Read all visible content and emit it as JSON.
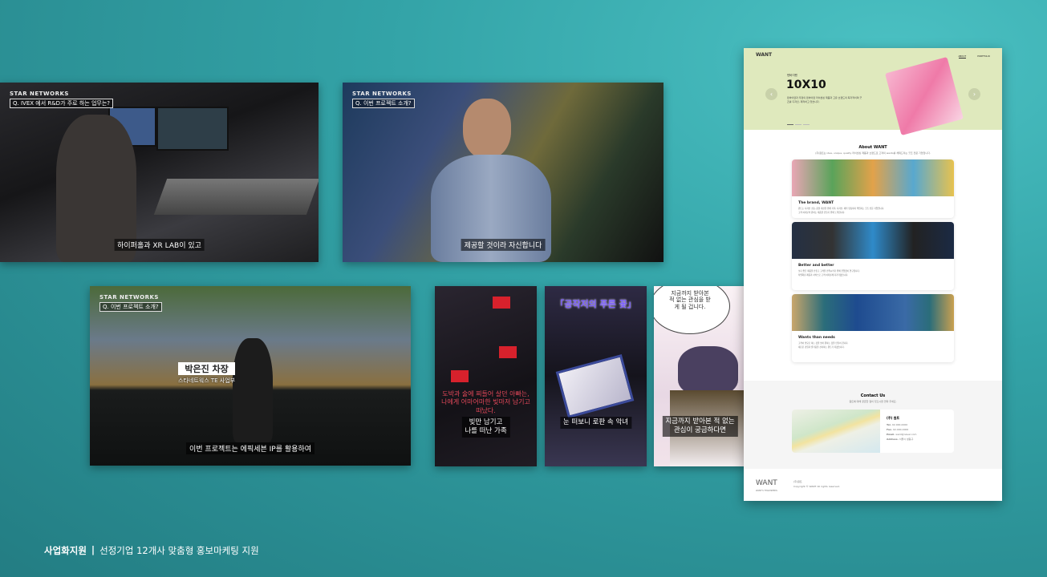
{
  "videos": [
    {
      "brand": "STAR NETWORKS",
      "question": "Q. IVEX 에서 R&D가 주로 하는 업무는?",
      "subtitle": "하이퍼홀과 XR LAB이 있고"
    },
    {
      "brand": "STAR NETWORKS",
      "question": "Q. 이번 프로젝트 소개?",
      "subtitle": "제공할 것이라 자신합니다"
    },
    {
      "brand": "STAR NETWORKS",
      "question": "Q. 이번 프로젝트 소개?",
      "subtitle": "이번 프로젝트는 에픽세븐 IP를 활용하여",
      "name": "박은진 차장",
      "role": "스타네트웍스 TE 사업부"
    }
  ],
  "comics": [
    {
      "overlay": "도박과 술에 찌들어 살던 아빠는, 나에게 어마어마한 빚마저 남기고 떠났다.",
      "caption_line1": "빚만 남기고",
      "caption_line2": "나를 떠난 가족"
    },
    {
      "title": "「공작저의 푸른 꽃」",
      "caption_line1": "눈 떠보니 로판 속 악녀"
    },
    {
      "bubble": "지금까지 받아본 적 없는 관심을 받게 될 겁니다.",
      "caption_line1": "지금까지 받아본 적 없는",
      "caption_line2": "관심이 궁금하다면"
    }
  ],
  "website": {
    "logo": "WANT",
    "nav": [
      "ABOUT",
      "PORTFOLIO"
    ],
    "hero": {
      "eyebrow": "텐바이텐",
      "title": "10X10",
      "desc": "텐바이텐과 우정의 텐바이텐 라이센싱 제품과 고유 브랜드의 독자적이며 굿즈를 디자인, 제작하고 있습니다."
    },
    "about": {
      "title": "About WANT",
      "desc": "(주)원트는 idea, unique, quality 라이센싱 제품과 브랜드로 고객의 wants를 채워드리는 굿즈 전문 기업입니다.",
      "cards": [
        {
          "title": "The brand, WANT",
          "text": [
            "원트는 디자인 소통, 품질 개선을 위해 기획, 디자인, 제작 유통까지 책임지는 굿즈 전문 기업입니다.",
            "고객 여러분의 원하는 제품을 만들기 위해 노력합니다."
          ]
        },
        {
          "title": "Better and better",
          "text": [
            "보다 좋은 제품을 만들고 고객을 만족시키기 위해 끊임없이 연구합니다.",
            "차별화된 제품과 서비스로 고객 여러분께 다가가겠습니다."
          ]
        },
        {
          "title": "Wants than needs",
          "text": [
            "고객이 필요로 하는 것을 넘어 원하는 것을 만들어 갑니다.",
            "새로운 경험과 즐거움을 선사하는 원트가 되겠습니다."
          ]
        }
      ]
    },
    "contact": {
      "title": "Contact Us",
      "desc": "원트에 대해 궁금한 점이 있으시면 연락 주세요.",
      "company": "(주) 원트",
      "tel_label": "Tel.",
      "tel": "02-000-0000",
      "fax_label": "Fax.",
      "fax": "02-000-0000",
      "email_label": "Email.",
      "email": "want@naver.com",
      "address_label": "Address.",
      "address": "서울시 성동구"
    },
    "footer": {
      "logo": "WANT",
      "sub": "WANT'S THAN NEEDS",
      "company": "(주)원트",
      "copyright": "Copyright © WANT All rights reserved."
    }
  },
  "caption": {
    "label": "사업화지원",
    "divider": "|",
    "text": "선정기업 12개사 맞춤형 홍보마케팅 지원"
  }
}
